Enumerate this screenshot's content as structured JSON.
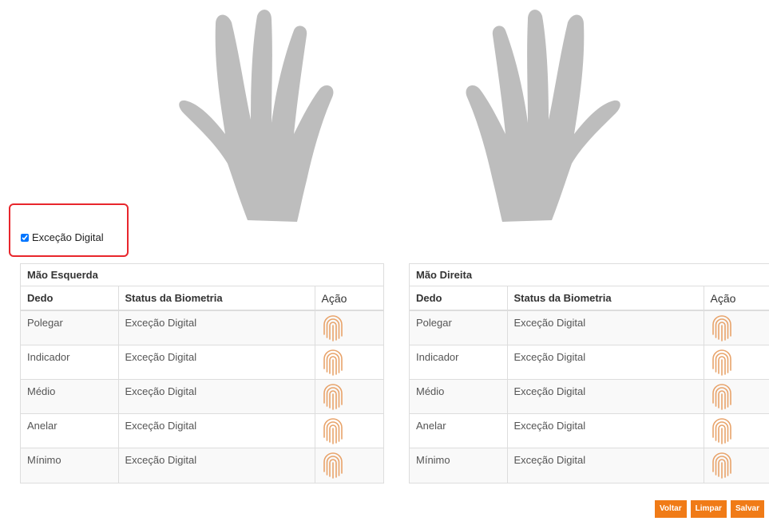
{
  "exception": {
    "label": "Exceção Digital",
    "checked": true
  },
  "left_table": {
    "title": "Mão Esquerda",
    "headers": {
      "finger": "Dedo",
      "status": "Status da Biometria",
      "action": "Ação"
    },
    "rows": [
      {
        "finger": "Polegar",
        "status": "Exceção Digital"
      },
      {
        "finger": "Indicador",
        "status": "Exceção Digital"
      },
      {
        "finger": "Médio",
        "status": "Exceção Digital"
      },
      {
        "finger": "Anelar",
        "status": "Exceção Digital"
      },
      {
        "finger": "Mínimo",
        "status": "Exceção Digital"
      }
    ]
  },
  "right_table": {
    "title": "Mão Direita",
    "headers": {
      "finger": "Dedo",
      "status": "Status da Biometria",
      "action": "Ação"
    },
    "rows": [
      {
        "finger": "Polegar",
        "status": "Exceção Digital"
      },
      {
        "finger": "Indicador",
        "status": "Exceção Digital"
      },
      {
        "finger": "Médio",
        "status": "Exceção Digital"
      },
      {
        "finger": "Anelar",
        "status": "Exceção Digital"
      },
      {
        "finger": "Mínimo",
        "status": "Exceção Digital"
      }
    ]
  },
  "actions": {
    "back_label": "Voltar",
    "clear_label": "Limpar",
    "save_label": "Salvar"
  },
  "icons": {
    "hand": "hand-silhouette-icon",
    "action": "fingerprint-icon"
  },
  "colors": {
    "accent": "#f07b17",
    "highlight_border": "#e8262c",
    "hand_fill": "#bdbdbd",
    "fingerprint": "#e8a36a"
  }
}
